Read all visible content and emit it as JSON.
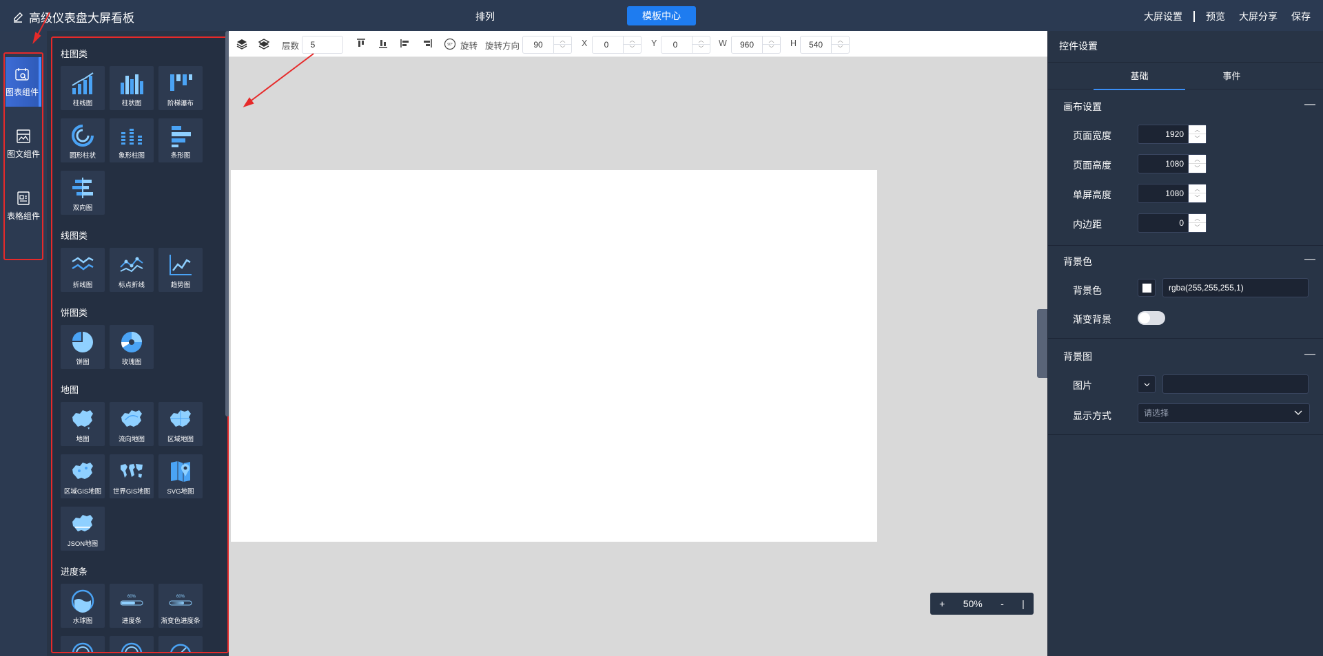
{
  "header": {
    "title": "高级仪表盘大屏看板",
    "nav_arrange": "排列",
    "nav_template": "模板中心",
    "menu": [
      "大屏设置",
      "预览",
      "大屏分享",
      "保存"
    ]
  },
  "rail": {
    "items": [
      {
        "label": "图表组件",
        "icon": "chart-icon",
        "active": true
      },
      {
        "label": "图文组件",
        "icon": "image-text-icon",
        "active": false
      },
      {
        "label": "表格组件",
        "icon": "table-icon",
        "active": false
      }
    ]
  },
  "panel": {
    "categories": [
      {
        "title": "柱图类",
        "items": [
          "柱线图",
          "柱状图",
          "阶梯瀑布",
          "圆形柱状",
          "象形柱图",
          "条形图",
          "双向图"
        ]
      },
      {
        "title": "线图类",
        "items": [
          "折线图",
          "标点折线",
          "趋势图"
        ]
      },
      {
        "title": "饼图类",
        "items": [
          "饼图",
          "玫瑰图"
        ]
      },
      {
        "title": "地图",
        "items": [
          "地图",
          "流向地图",
          "区域地图",
          "区域GIS地图",
          "世界GIS地图",
          "SVG地图",
          "JSON地图"
        ]
      },
      {
        "title": "进度条",
        "items": [
          "水球图",
          "进度条",
          "渐变色进度条"
        ]
      }
    ],
    "progress_badge": "60%"
  },
  "toolbar": {
    "layer_label": "层数",
    "layer_value": "5",
    "rotate_icon_label": "90°",
    "rotate_label": "旋转",
    "rotate_dir_label": "旋转方向",
    "rotate_value": "90",
    "x_label": "X",
    "x_value": "0",
    "y_label": "Y",
    "y_value": "0",
    "w_label": "W",
    "w_value": "960",
    "h_label": "H",
    "h_value": "540"
  },
  "zoom": {
    "plus": "+",
    "value": "50%",
    "minus": "-",
    "bar": "|"
  },
  "props": {
    "title": "控件设置",
    "tabs": [
      "基础",
      "事件"
    ],
    "canvas_section": "画布设置",
    "page_width_label": "页面宽度",
    "page_width": "1920",
    "page_height_label": "页面高度",
    "page_height": "1080",
    "screen_height_label": "单屏高度",
    "screen_height": "1080",
    "padding_label": "内边距",
    "padding": "0",
    "bg_section": "背景色",
    "bg_color_label": "背景色",
    "bg_color_value": "rgba(255,255,255,1)",
    "gradient_label": "渐变背景",
    "gradient_on": false,
    "bgimg_section": "背景图",
    "image_label": "图片",
    "display_label": "显示方式",
    "display_placeholder": "请选择",
    "collapse_symbol": "—"
  },
  "colors": {
    "accent": "#1e7cf0",
    "annotation": "#e62a2a",
    "icon_blue": "#4aa3f5",
    "icon_light": "#8fd0ff"
  }
}
